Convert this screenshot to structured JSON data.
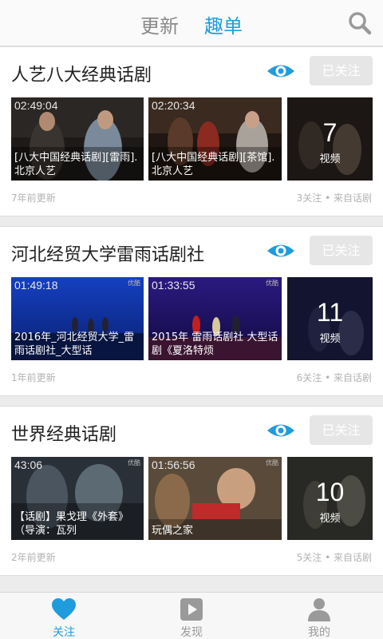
{
  "header": {
    "tabs": [
      {
        "label": "更新",
        "active": false
      },
      {
        "label": "趣单",
        "active": true
      }
    ],
    "search_icon": "search-icon",
    "accent_color": "#1f9cdc"
  },
  "cards": [
    {
      "title": "人艺八大经典话剧",
      "follow_label": "已关注",
      "videos": [
        {
          "duration": "02:49:04",
          "caption": "[八大中国经典话剧][雷雨].北京人艺"
        },
        {
          "duration": "02:20:34",
          "caption": "[八大中国经典话剧][茶馆].北京人艺"
        }
      ],
      "count": "7",
      "count_label": "视频",
      "updated": "7年前更新",
      "stats": "3关注 • 来自话剧"
    },
    {
      "title": "河北经贸大学雷雨话剧社",
      "follow_label": "已关注",
      "videos": [
        {
          "duration": "01:49:18",
          "caption": "2016年_河北经贸大学_雷雨话剧社_大型话",
          "watermark": "优酷"
        },
        {
          "duration": "01:33:55",
          "caption": "2015年 雷雨话剧社 大型话剧《夏洛特烦",
          "watermark": "优酷"
        }
      ],
      "count": "11",
      "count_label": "视频",
      "updated": "1年前更新",
      "stats": "6关注 • 来自话剧"
    },
    {
      "title": "世界经典话剧",
      "follow_label": "已关注",
      "videos": [
        {
          "duration": "43:06",
          "caption": "【话剧】果戈理《外套》（导演：瓦列",
          "watermark": "优酷"
        },
        {
          "duration": "01:56:56",
          "caption": "玩偶之家",
          "watermark": "优酷"
        }
      ],
      "count": "10",
      "count_label": "视频",
      "updated": "2年前更新",
      "stats": "5关注 • 来自话剧"
    }
  ],
  "bottom_nav": [
    {
      "label": "关注",
      "icon": "heart-icon",
      "active": true
    },
    {
      "label": "发现",
      "icon": "play-icon",
      "active": false
    },
    {
      "label": "我的",
      "icon": "person-icon",
      "active": false
    }
  ]
}
